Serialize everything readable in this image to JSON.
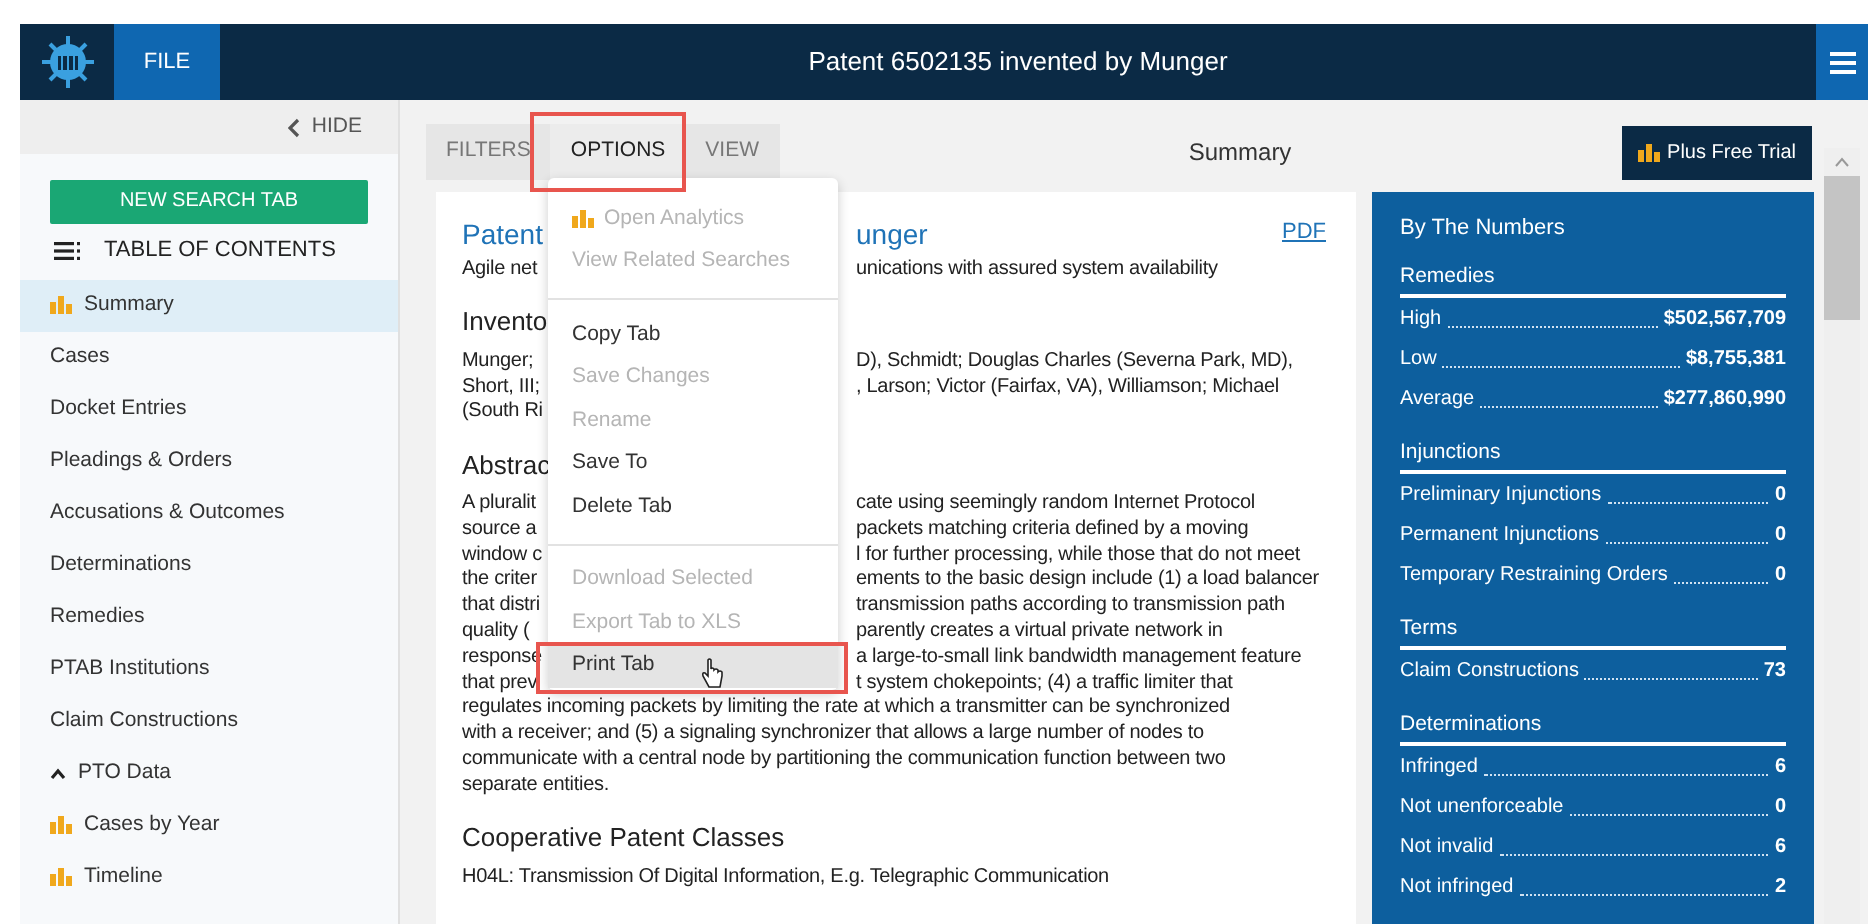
{
  "header": {
    "file_button": "FILE",
    "title": "Patent 6502135 invented by Munger"
  },
  "sidebar": {
    "hide_label": "HIDE",
    "new_search_button": "NEW SEARCH TAB",
    "toc_label": "TABLE OF CONTENTS",
    "items": [
      {
        "label": "Summary",
        "kind": "chart",
        "selected": true
      },
      {
        "label": "Cases",
        "kind": "plain",
        "selected": false
      },
      {
        "label": "Docket Entries",
        "kind": "plain",
        "selected": false
      },
      {
        "label": "Pleadings & Orders",
        "kind": "plain",
        "selected": false
      },
      {
        "label": "Accusations & Outcomes",
        "kind": "plain",
        "selected": false
      },
      {
        "label": "Determinations",
        "kind": "plain",
        "selected": false
      },
      {
        "label": "Remedies",
        "kind": "plain",
        "selected": false
      },
      {
        "label": "PTAB Institutions",
        "kind": "plain",
        "selected": false
      },
      {
        "label": "Claim Constructions",
        "kind": "plain",
        "selected": false
      },
      {
        "label": "PTO Data",
        "kind": "group",
        "selected": false,
        "expanded": true,
        "children": [
          {
            "label": "Cases by Year",
            "kind": "chart",
            "selected": false
          },
          {
            "label": "Timeline",
            "kind": "chart",
            "selected": false
          }
        ]
      }
    ]
  },
  "tabs": [
    {
      "label": "FILTERS",
      "selected": false
    },
    {
      "label": "OPTIONS",
      "selected": true
    },
    {
      "label": "VIEW",
      "selected": false
    }
  ],
  "panel_title": "Summary",
  "trial_button": "Plus Free Trial",
  "document": {
    "pdf_link": "PDF",
    "lines": [
      {
        "kind": "title",
        "left": "Patent",
        "right": "unger"
      },
      {
        "kind": "text",
        "left": "Agile net",
        "right": "unications with assured system availability"
      },
      {
        "kind": "heading",
        "left": "Invento"
      },
      {
        "kind": "text",
        "left": "Munger;",
        "right": "D), Schmidt; Douglas Charles (Severna Park, MD),"
      },
      {
        "kind": "text",
        "left": "Short, III;",
        "right": ", Larson; Victor (Fairfax, VA), Williamson; Michael"
      },
      {
        "kind": "text",
        "left": "(South Ri"
      },
      {
        "kind": "heading",
        "left": "Abstrac"
      },
      {
        "kind": "text",
        "left": "A pluralit",
        "right": "cate using seemingly random Internet Protocol"
      },
      {
        "kind": "text",
        "left": "source a",
        "right": "packets matching criteria defined by a moving"
      },
      {
        "kind": "text",
        "left": "window c",
        "right": "l for further processing, while those that do not meet"
      },
      {
        "kind": "text",
        "left": "the criter",
        "right": "ements to the basic design include (1) a load balancer"
      },
      {
        "kind": "text",
        "left": "that distri",
        "right": "transmission paths according to transmission path"
      },
      {
        "kind": "text",
        "left": "quality (",
        "right": "parently creates a virtual private network in"
      },
      {
        "kind": "text",
        "left": "response",
        "right": "a large-to-small link bandwidth management feature"
      },
      {
        "kind": "text",
        "left": "that prev",
        "right": "t system chokepoints; (4) a traffic limiter that"
      },
      {
        "kind": "text",
        "left": "regulates incoming packets by limiting the rate at which a transmitter can be synchronized"
      },
      {
        "kind": "text",
        "left": "with a receiver; and (5) a signaling synchronizer that allows a large number of nodes to"
      },
      {
        "kind": "text",
        "left": "communicate with a central node by partitioning the communication function between two"
      },
      {
        "kind": "text",
        "left": "separate entities."
      },
      {
        "kind": "heading",
        "left": "Cooperative Patent Classes"
      },
      {
        "kind": "text",
        "left": "H04L: Transmission Of Digital Information, E.g. Telegraphic Communication"
      }
    ]
  },
  "menu": {
    "items": [
      {
        "kind": "chart",
        "label": "Open Analytics",
        "disabled": true,
        "selected": false
      },
      {
        "kind": "item",
        "label": "View Related Searches",
        "disabled": true,
        "selected": false
      },
      {
        "kind": "divider"
      },
      {
        "kind": "item",
        "label": "Copy Tab",
        "disabled": false,
        "selected": false
      },
      {
        "kind": "item",
        "label": "Save Changes",
        "disabled": true,
        "selected": false
      },
      {
        "kind": "item",
        "label": "Rename",
        "disabled": true,
        "selected": false
      },
      {
        "kind": "item",
        "label": "Save To",
        "disabled": false,
        "selected": false
      },
      {
        "kind": "item",
        "label": "Delete Tab",
        "disabled": false,
        "selected": false
      },
      {
        "kind": "divider"
      },
      {
        "kind": "item",
        "label": "Download Selected",
        "disabled": true,
        "selected": false
      },
      {
        "kind": "item",
        "label": "Export Tab to XLS",
        "disabled": true,
        "selected": false
      },
      {
        "kind": "item",
        "label": "Print Tab",
        "disabled": false,
        "selected": true
      }
    ]
  },
  "numbers": {
    "title": "By The Numbers",
    "sections": [
      {
        "heading": "Remedies",
        "rows": [
          {
            "label": "High",
            "value": "$502,567,709"
          },
          {
            "label": "Low",
            "value": "$8,755,381"
          },
          {
            "label": "Average",
            "value": "$277,860,990"
          }
        ]
      },
      {
        "heading": "Injunctions",
        "rows": [
          {
            "label": "Preliminary Injunctions",
            "value": "0"
          },
          {
            "label": "Permanent Injunctions",
            "value": "0"
          },
          {
            "label": "Temporary Restraining Orders",
            "value": "0"
          }
        ]
      },
      {
        "heading": "Terms",
        "rows": [
          {
            "label": "Claim Constructions",
            "value": "73"
          }
        ]
      },
      {
        "heading": "Determinations",
        "rows": [
          {
            "label": "Infringed",
            "value": "6"
          },
          {
            "label": "Not unenforceable",
            "value": "0"
          },
          {
            "label": "Not invalid",
            "value": "6"
          },
          {
            "label": "Not infringed",
            "value": "2"
          }
        ]
      }
    ]
  }
}
